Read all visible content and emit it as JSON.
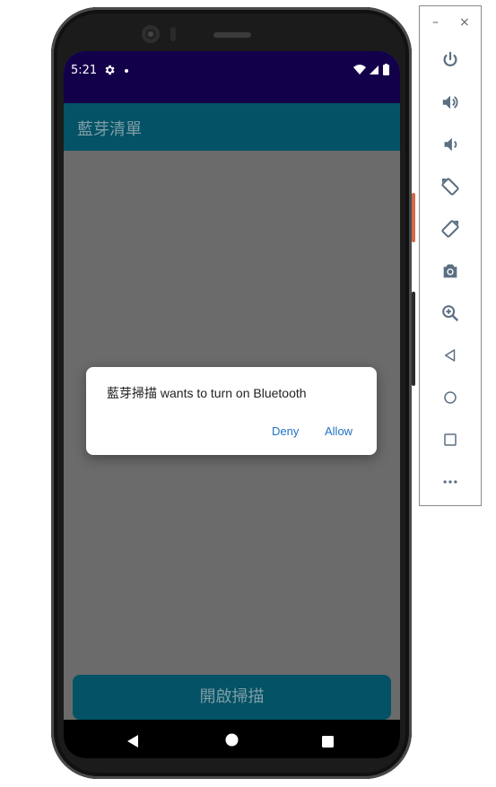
{
  "status_bar": {
    "time": "5:21"
  },
  "app_bar": {
    "title": "藍芽清單"
  },
  "main": {
    "scan_button_label": "開啟掃描"
  },
  "dialog": {
    "message": "藍芽掃描 wants to turn on Bluetooth",
    "deny_label": "Deny",
    "allow_label": "Allow"
  },
  "emulator_toolbar": {
    "minimize_label": "–",
    "close_label": "×",
    "buttons": [
      "power-icon",
      "volume-up-icon",
      "volume-down-icon",
      "rotate-left-icon",
      "rotate-right-icon",
      "camera-icon",
      "zoom-icon",
      "back-icon",
      "home-icon",
      "overview-icon",
      "more-icon"
    ]
  },
  "colors": {
    "status_bar": "#13004a",
    "app_bar": "#045265",
    "scrim": "#6b6b6b",
    "dialog_button": "#1f73c4",
    "toolbar_icon": "#5b6e82"
  }
}
